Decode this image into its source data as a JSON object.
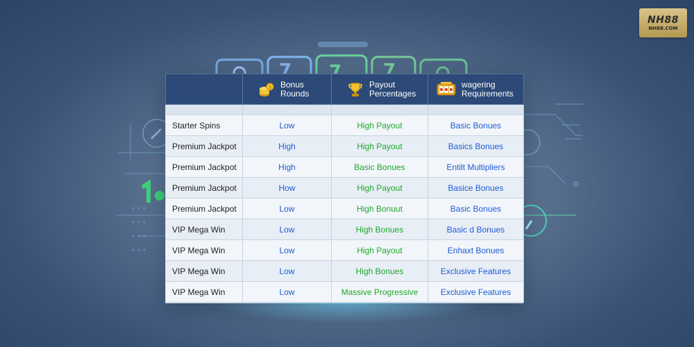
{
  "logo": {
    "main": "NH88",
    "sub": "NH88.COM"
  },
  "table": {
    "headers": [
      {
        "label": "",
        "icon": ""
      },
      {
        "label": "Bonus Rounds",
        "line1": "Bonus",
        "line2": "Rounds",
        "icon": "coins-icon"
      },
      {
        "label": "Payout Percentages",
        "line1": "Payout",
        "line2": "Percentages",
        "icon": "trophy-icon"
      },
      {
        "label": "wagering Requirements",
        "line1": "wagering",
        "line2": "Requirements",
        "icon": "slot-machine-icon"
      }
    ],
    "rows": [
      [
        "Starter Spins",
        "Low",
        "High Payout",
        "Basic Bonues"
      ],
      [
        "Premium Jackpot",
        "High",
        "High Payout",
        "Basics Bonues"
      ],
      [
        "Premium Jackpot",
        "High",
        "Basic Bonues",
        "Entilt Multipliers"
      ],
      [
        "Premium Jackpot",
        "How",
        "High Payout",
        "Basice Bonues"
      ],
      [
        "Premium Jackpot",
        "Low",
        "High Bonuut",
        "Basic Bonues"
      ],
      [
        "VIP Mega Win",
        "Low",
        "High Bonues",
        "Basic d Bonues"
      ],
      [
        "VIP Mega Win",
        "Low",
        "High Payout",
        "Enhaxt Bonues"
      ],
      [
        "VIP Mega Win",
        "Low",
        "High Bonues",
        "Exclusive Features"
      ],
      [
        "VIP Mega Win",
        "Low",
        "Massive Progressive",
        "Exclusive Features"
      ]
    ]
  },
  "colors": {
    "header_bg": "#2c4977",
    "blue_text": "#1f5bd1",
    "green_text": "#1ea62a",
    "logo_gold": "#c9b06a"
  }
}
